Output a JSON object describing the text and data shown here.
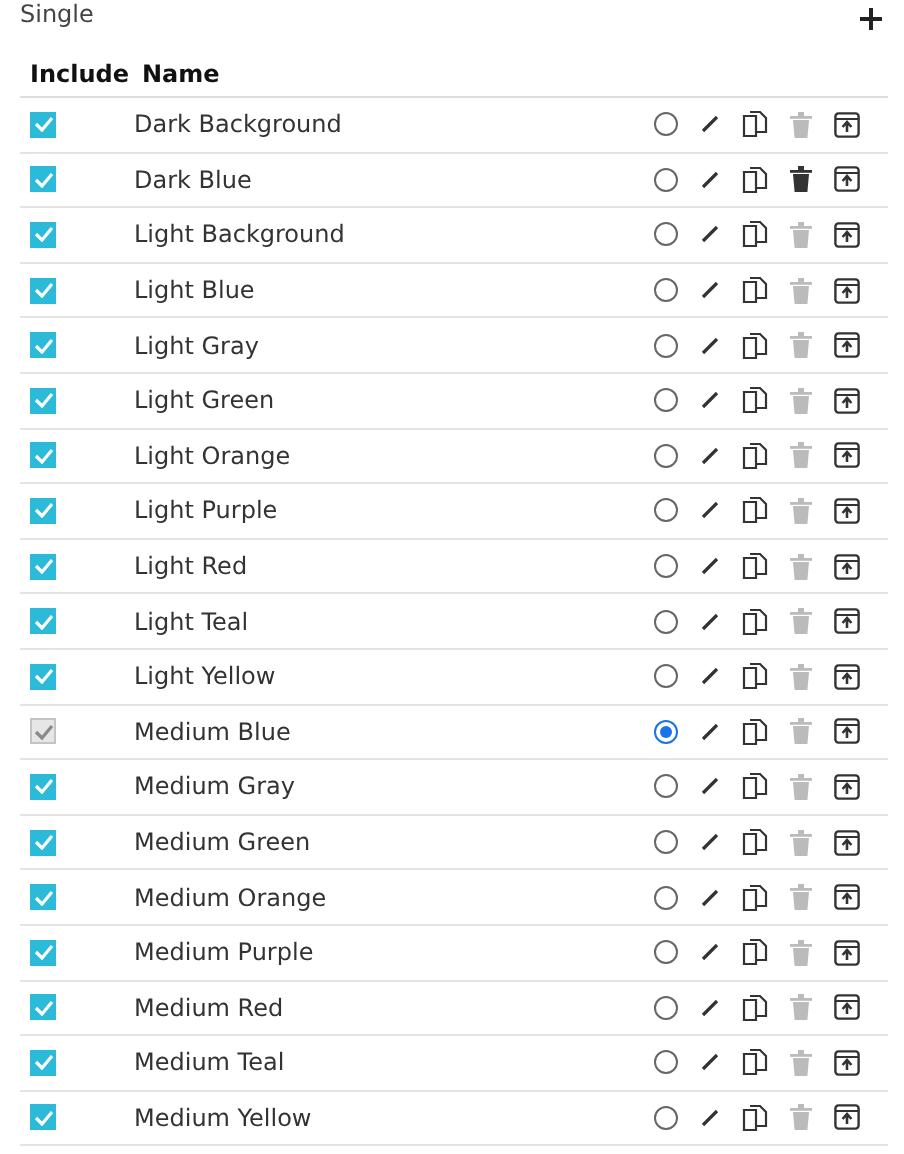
{
  "section": {
    "title": "Single"
  },
  "columns": [
    "Include",
    "Name"
  ],
  "rows": [
    {
      "name": "Dark Background",
      "included": true,
      "include_disabled": false,
      "selected": false,
      "deletable": false
    },
    {
      "name": "Dark Blue",
      "included": true,
      "include_disabled": false,
      "selected": false,
      "deletable": true
    },
    {
      "name": "Light Background",
      "included": true,
      "include_disabled": false,
      "selected": false,
      "deletable": false
    },
    {
      "name": "Light Blue",
      "included": true,
      "include_disabled": false,
      "selected": false,
      "deletable": false
    },
    {
      "name": "Light Gray",
      "included": true,
      "include_disabled": false,
      "selected": false,
      "deletable": false
    },
    {
      "name": "Light Green",
      "included": true,
      "include_disabled": false,
      "selected": false,
      "deletable": false
    },
    {
      "name": "Light Orange",
      "included": true,
      "include_disabled": false,
      "selected": false,
      "deletable": false
    },
    {
      "name": "Light Purple",
      "included": true,
      "include_disabled": false,
      "selected": false,
      "deletable": false
    },
    {
      "name": "Light Red",
      "included": true,
      "include_disabled": false,
      "selected": false,
      "deletable": false
    },
    {
      "name": "Light Teal",
      "included": true,
      "include_disabled": false,
      "selected": false,
      "deletable": false
    },
    {
      "name": "Light Yellow",
      "included": true,
      "include_disabled": false,
      "selected": false,
      "deletable": false
    },
    {
      "name": "Medium Blue",
      "included": true,
      "include_disabled": true,
      "selected": true,
      "deletable": false
    },
    {
      "name": "Medium Gray",
      "included": true,
      "include_disabled": false,
      "selected": false,
      "deletable": false
    },
    {
      "name": "Medium Green",
      "included": true,
      "include_disabled": false,
      "selected": false,
      "deletable": false
    },
    {
      "name": "Medium Orange",
      "included": true,
      "include_disabled": false,
      "selected": false,
      "deletable": false
    },
    {
      "name": "Medium Purple",
      "included": true,
      "include_disabled": false,
      "selected": false,
      "deletable": false
    },
    {
      "name": "Medium Red",
      "included": true,
      "include_disabled": false,
      "selected": false,
      "deletable": false
    },
    {
      "name": "Medium Teal",
      "included": true,
      "include_disabled": false,
      "selected": false,
      "deletable": false
    },
    {
      "name": "Medium Yellow",
      "included": true,
      "include_disabled": false,
      "selected": false,
      "deletable": false
    }
  ]
}
